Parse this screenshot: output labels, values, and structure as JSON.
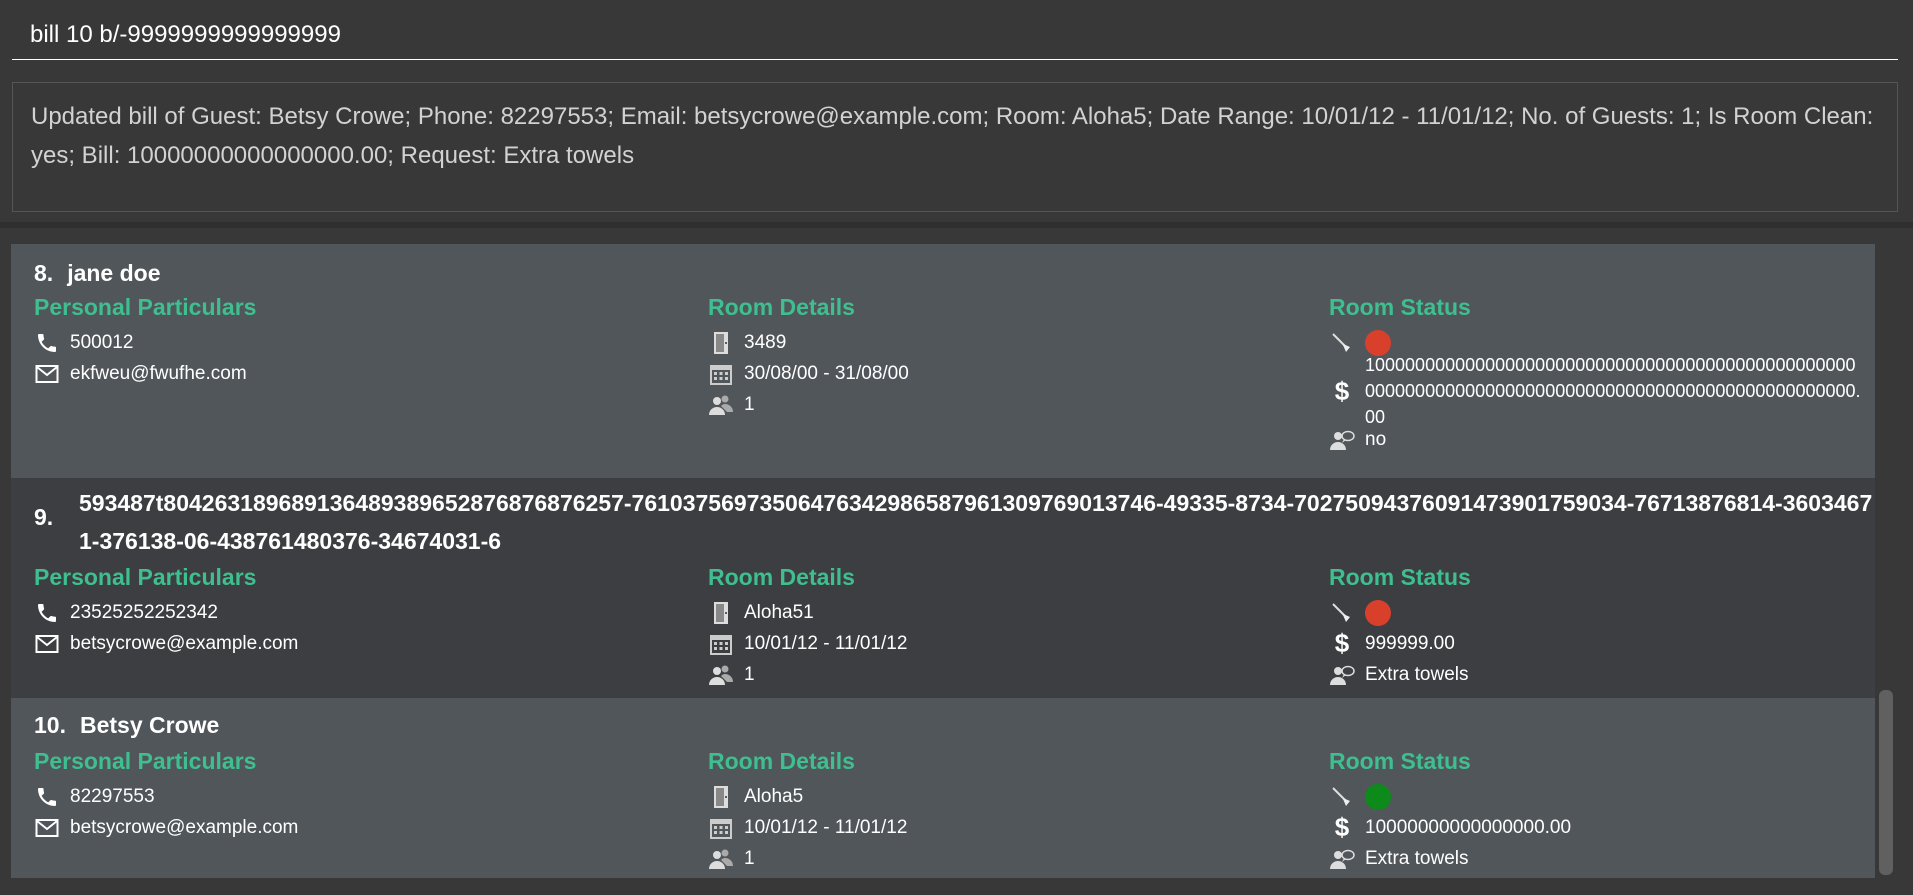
{
  "command": {
    "value": "bill 10 b/-9999999999999999"
  },
  "result": {
    "text": "Updated bill of Guest: Betsy Crowe; Phone: 82297553; Email: betsycrowe@example.com; Room: Aloha5; Date Range: 10/01/12 - 11/01/12; No. of Guests: 1; Is Room Clean: yes; Bill: 10000000000000000.00; Request: Extra towels"
  },
  "labels": {
    "personal": "Personal Particulars",
    "room_details": "Room Details",
    "room_status": "Room Status"
  },
  "colors": {
    "accent": "#3fbf8f",
    "dirty": "#d9402b",
    "clean": "#0c8a1a"
  },
  "guests": [
    {
      "index": "8.",
      "name": "jane doe",
      "phone": "500012",
      "email": "ekfweu@fwufhe.com",
      "room": "3489",
      "date_range": "30/08/00 - 31/08/00",
      "num_guests": "1",
      "clean": false,
      "bill": "10000000000000000000000000000000000000000000000000000000000000000000000000000000000000000000000000.00",
      "request": "no"
    },
    {
      "index": "9.",
      "name": "593487t804263189689136489389652876876876257-76103756973506476342986587961309769013746-49335-8734-70275094376091473901759034-76713876814-36034671-376138-06-438761480376-34674031-6",
      "phone": "23525252252342",
      "email": "betsycrowe@example.com",
      "room": "Aloha51",
      "date_range": "10/01/12 - 11/01/12",
      "num_guests": "1",
      "clean": false,
      "bill": "999999.00",
      "request": "Extra towels"
    },
    {
      "index": "10.",
      "name": "Betsy Crowe",
      "phone": "82297553",
      "email": "betsycrowe@example.com",
      "room": "Aloha5",
      "date_range": "10/01/12 - 11/01/12",
      "num_guests": "1",
      "clean": true,
      "bill": "10000000000000000.00",
      "request": "Extra towels"
    }
  ]
}
